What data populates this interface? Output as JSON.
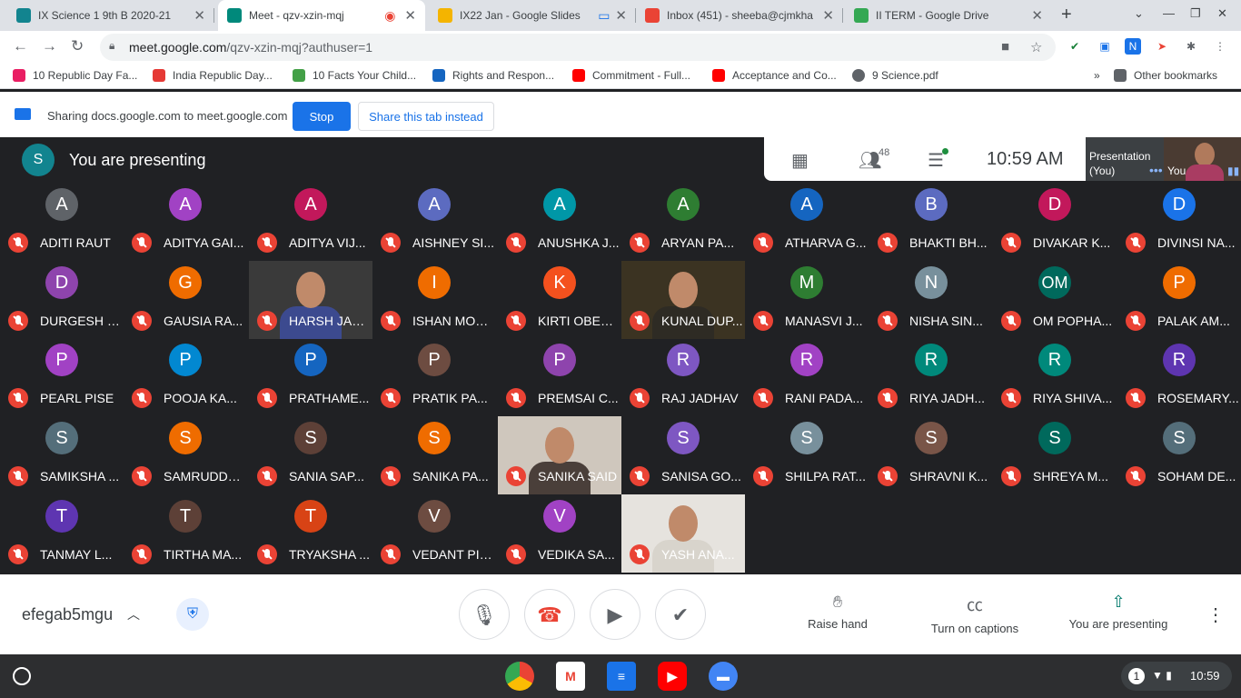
{
  "tabs": [
    {
      "title": "IX Science 1 9th B 2020-21",
      "color": "#12848f"
    },
    {
      "title": "Meet - qzv-xzin-mqj",
      "color": "#00897b"
    },
    {
      "title": "IX22 Jan - Google Slides",
      "color": "#f4b400"
    },
    {
      "title": "Inbox (451) - sheeba@cjmkha",
      "color": "#ea4335"
    },
    {
      "title": "II TERM - Google Drive",
      "color": "#34a853"
    }
  ],
  "toolbar": {
    "url_main": "meet.google.com",
    "url_rest": "/qzv-xzin-mqj?authuser=1"
  },
  "bookmarks": [
    {
      "label": "10 Republic Day Fa...",
      "color": "#e91e63"
    },
    {
      "label": "India Republic Day...",
      "color": "#e53935"
    },
    {
      "label": "10 Facts Your Child...",
      "color": "#43a047"
    },
    {
      "label": "Rights and Respon...",
      "color": "#1565c0"
    },
    {
      "label": "Commitment - Full...",
      "color": "#ff0000"
    },
    {
      "label": "Acceptance and Co...",
      "color": "#ff0000"
    },
    {
      "label": "9 Science.pdf",
      "color": "#5f6368"
    },
    {
      "label": "Other bookmarks",
      "color": "#5f6368"
    }
  ],
  "sharebar": {
    "text": "Sharing docs.google.com to meet.google.com",
    "stop_label": "Stop",
    "share_label": "Share this tab instead"
  },
  "meet": {
    "presenting_initial": "S",
    "presenting_text": "You are presenting",
    "people_count": "48",
    "clock": "10:59 AM",
    "presentation_tile_label": "Presentation\n(You)",
    "you_label": "You",
    "meeting_code": "efegab5mgu",
    "actions": {
      "raise_hand": "Raise hand",
      "captions": "Turn on captions",
      "presenting": "You are presenting"
    }
  },
  "participants": [
    {
      "initial": "A",
      "name": "ADITI RAUT",
      "color": "#5f6368"
    },
    {
      "initial": "A",
      "name": "ADITYA GAI...",
      "color": "#a142c4"
    },
    {
      "initial": "A",
      "name": "ADITYA VIJ...",
      "color": "#c2185b"
    },
    {
      "initial": "A",
      "name": "AISHNEY SI...",
      "color": "#5c6bc0"
    },
    {
      "initial": "A",
      "name": "ANUSHKA J...",
      "color": "#0097a7"
    },
    {
      "initial": "A",
      "name": "ARYAN PA...",
      "color": "#2e7d32"
    },
    {
      "initial": "A",
      "name": "ATHARVA G...",
      "color": "#1565c0"
    },
    {
      "initial": "B",
      "name": "BHAKTI BH...",
      "color": "#5c6bc0"
    },
    {
      "initial": "D",
      "name": "DIVAKAR K...",
      "color": "#c2185b"
    },
    {
      "initial": "D",
      "name": "DIVINSI NA...",
      "color": "#1a73e8"
    },
    {
      "initial": "D",
      "name": "DURGESH P...",
      "color": "#8e44ad"
    },
    {
      "initial": "G",
      "name": "GAUSIA RA...",
      "color": "#ef6c00"
    },
    {
      "initial": "",
      "name": "HARSH JAD...",
      "color": "#3a3a3a",
      "video": true,
      "shirt": "#3c4a8f"
    },
    {
      "initial": "I",
      "name": "ISHAN MOR...",
      "color": "#ef6c00"
    },
    {
      "initial": "K",
      "name": "KIRTI OBEROI",
      "color": "#f4511e"
    },
    {
      "initial": "",
      "name": "KUNAL DUP...",
      "color": "#3b3322",
      "video": true,
      "shirt": "#2e2b24"
    },
    {
      "initial": "M",
      "name": "MANASVI J...",
      "color": "#2e7d32"
    },
    {
      "initial": "N",
      "name": "NISHA SIN...",
      "color": "#78909c"
    },
    {
      "initial": "OM",
      "name": "OM POPHA...",
      "color": "#00695c"
    },
    {
      "initial": "P",
      "name": "PALAK AM...",
      "color": "#ef6c00"
    },
    {
      "initial": "P",
      "name": "PEARL PISE",
      "color": "#a142c4"
    },
    {
      "initial": "P",
      "name": "POOJA KA...",
      "color": "#0288d1"
    },
    {
      "initial": "P",
      "name": "PRATHAME...",
      "color": "#1565c0"
    },
    {
      "initial": "P",
      "name": "PRATIK PA...",
      "color": "#6d4c41"
    },
    {
      "initial": "P",
      "name": "PREMSAI C...",
      "color": "#8e44ad"
    },
    {
      "initial": "R",
      "name": "RAJ JADHAV",
      "color": "#7e57c2"
    },
    {
      "initial": "R",
      "name": "RANI PADA...",
      "color": "#a142c4"
    },
    {
      "initial": "R",
      "name": "RIYA JADH...",
      "color": "#00897b"
    },
    {
      "initial": "R",
      "name": "RIYA SHIVA...",
      "color": "#00897b"
    },
    {
      "initial": "R",
      "name": "ROSEMARY...",
      "color": "#5e35b1"
    },
    {
      "initial": "S",
      "name": "SAMIKSHA ...",
      "color": "#546e7a"
    },
    {
      "initial": "S",
      "name": "SAMRUDDH...",
      "color": "#ef6c00"
    },
    {
      "initial": "S",
      "name": "SANIA SAP...",
      "color": "#5d4037"
    },
    {
      "initial": "S",
      "name": "SANIKA PA...",
      "color": "#ef6c00"
    },
    {
      "initial": "",
      "name": "SANIKA SAID",
      "color": "#cfc7bd",
      "video": true,
      "shirt": "#4a3f3a"
    },
    {
      "initial": "S",
      "name": "SANISA GO...",
      "color": "#7e57c2"
    },
    {
      "initial": "S",
      "name": "SHILPA RAT...",
      "color": "#78909c"
    },
    {
      "initial": "S",
      "name": "SHRAVNI K...",
      "color": "#795548"
    },
    {
      "initial": "S",
      "name": "SHREYA M...",
      "color": "#00695c"
    },
    {
      "initial": "S",
      "name": "SOHAM DE...",
      "color": "#546e7a"
    },
    {
      "initial": "T",
      "name": "TANMAY L...",
      "color": "#5e35b1"
    },
    {
      "initial": "T",
      "name": "TIRTHA MA...",
      "color": "#5d4037"
    },
    {
      "initial": "T",
      "name": "TRYAKSHA ...",
      "color": "#d84315"
    },
    {
      "initial": "V",
      "name": "VEDANT PISE",
      "color": "#6d4c41"
    },
    {
      "initial": "V",
      "name": "VEDIKA SA...",
      "color": "#a142c4"
    },
    {
      "initial": "",
      "name": "YASH ANA...",
      "color": "#e6e3de",
      "video": true,
      "shirt": "#d8d4cc"
    }
  ],
  "shelf": {
    "notification_count": "1",
    "time": "10:59"
  }
}
